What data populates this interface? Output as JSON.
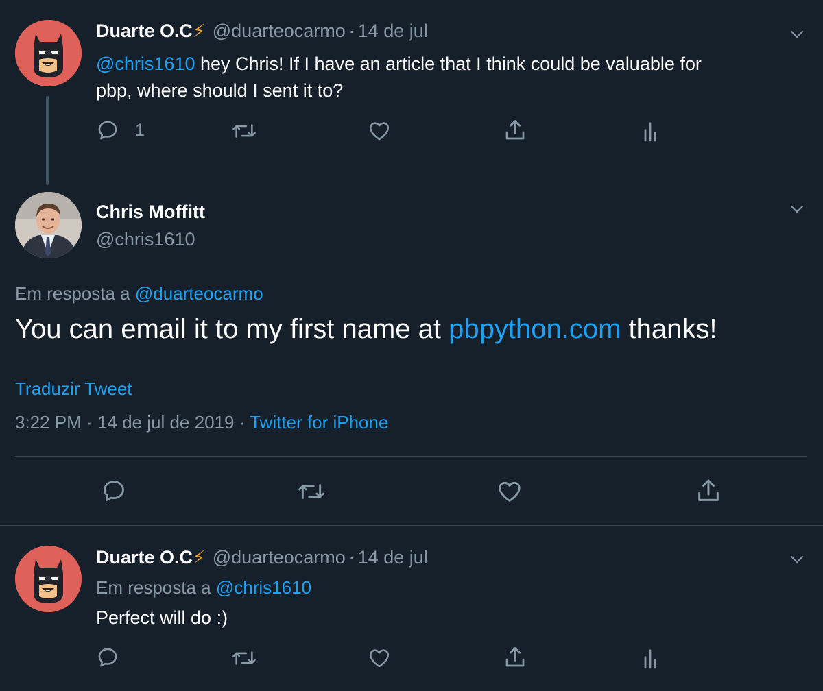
{
  "tweet1": {
    "name": "Duarte O.C",
    "bolt": "⚡",
    "handle": "@duarteocarmo",
    "sep": "·",
    "date": "14 de jul",
    "mention": "@chris1610",
    "text_line1": " hey Chris! If I have an article that I think could be valuable for",
    "text_line2": "pbp, where should I sent it to?",
    "reply_count": "1"
  },
  "tweet2": {
    "name": "Chris Moffitt",
    "handle": "@chris1610",
    "reply_prefix": "Em resposta a ",
    "reply_handle": "@duarteocarmo",
    "text_before": "You can email it to my first name at ",
    "text_link": "pbpython.com",
    "text_after": " thanks!",
    "translate": "Traduzir Tweet",
    "time": "3:22 PM",
    "sep1": " · ",
    "date": "14 de jul de 2019",
    "sep2": " · ",
    "source": "Twitter for iPhone"
  },
  "tweet3": {
    "name": "Duarte O.C",
    "bolt": "⚡",
    "handle": "@duarteocarmo",
    "sep": "·",
    "date": "14 de jul",
    "reply_prefix": "Em resposta a ",
    "reply_handle": "@chris1610",
    "text": "Perfect will do :)"
  },
  "colors": {
    "background": "#15202b",
    "accent": "#1da1f2",
    "muted": "#8899a6",
    "divider": "#38444d"
  }
}
